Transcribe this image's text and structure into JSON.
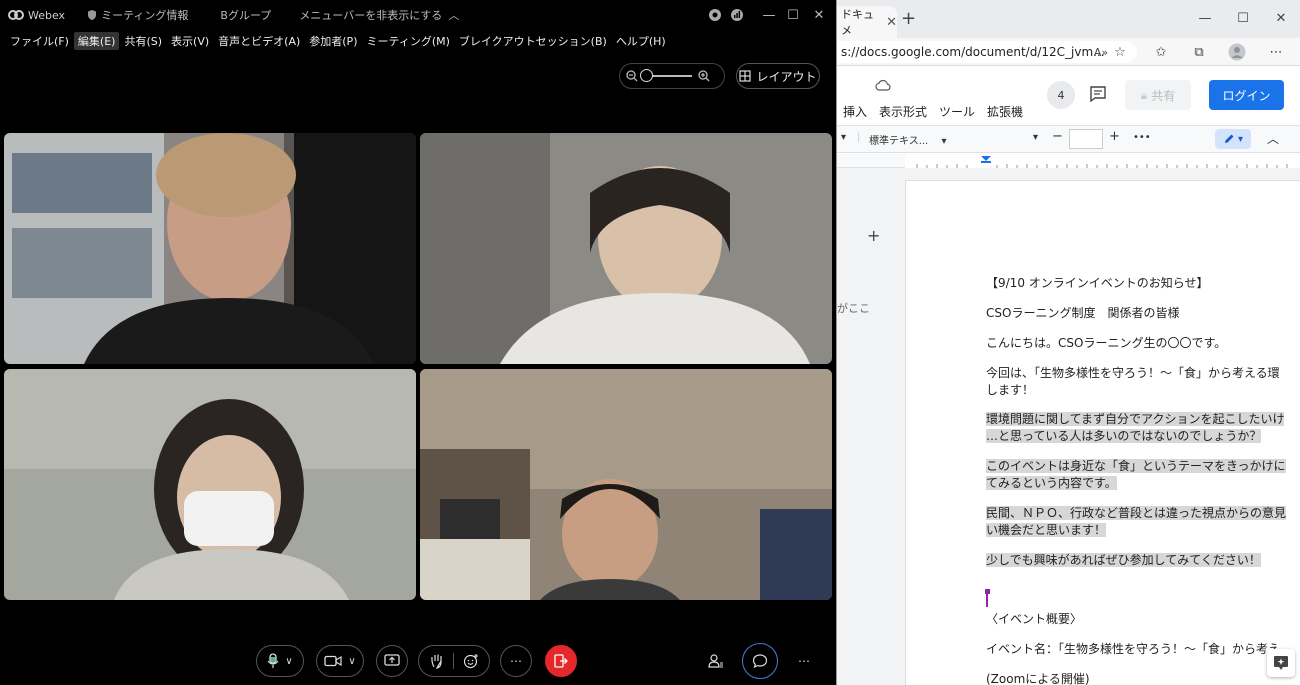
{
  "webex": {
    "app_name": "Webex",
    "meeting_info": "ミーティング情報",
    "group_name": "Bグループ",
    "hide_menubar": "メニューバーを非表示にする",
    "menus": [
      "ファイル(F)",
      "編集(E)",
      "共有(S)",
      "表示(V)",
      "音声とビデオ(A)",
      "参加者(P)",
      "ミーティング(M)",
      "ブレイクアウトセッション(B)",
      "ヘルプ(H)"
    ],
    "layout_label": "レイアウト",
    "controls": {
      "mic": "microphone-icon",
      "video": "video-camera-icon",
      "share": "share-screen-icon",
      "raise_hand": "raise-hand-icon",
      "reactions": "reactions-icon",
      "more": "more-icon",
      "leave": "leave-meeting-icon",
      "participants": "participants-icon",
      "chat": "chat-icon"
    }
  },
  "browser": {
    "tab_title": "ドキュメ",
    "url": "s://docs.google.com/document/d/12C_jvm...",
    "docs_menus": [
      "挿入",
      "表示形式",
      "ツール",
      "拡張機"
    ],
    "comment_count": "4",
    "share_label": "共有",
    "login_label": "ログイン",
    "style_selector": "標準テキス...",
    "font_size": "",
    "side_text": "がここ",
    "doc": {
      "title": "【9/10 オンラインイベントのお知らせ】",
      "greeting_to": "CSOラーニング制度　関係者の皆様",
      "hello": "こんにちは。CSOラーニング生の〇〇です。",
      "p1_l1": "今回は、「生物多様性を守ろう！～「食」から考える環",
      "p1_l2": "します！",
      "p2_l1": "環境問題に関してまず自分でアクションを起こしたいけ",
      "p2_l2": "…と思っている人は多いのではないのでしょうか？",
      "p3_l1": "このイベントは身近な「食」というテーマをきっかけに",
      "p3_l2": "てみるという内容です。",
      "p4_l1": "民間、ＮＰＯ、行政など普段とは違った視点からの意見",
      "p4_l2": "い機会だと思います！",
      "p5": "少しでも興味があればぜひ参加してみてください！",
      "overview": "〈イベント概要〉",
      "event_name": "イベント名：「生物多様性を守ろう！～「食」から考え",
      "zoom": "(Zoomによる開催)"
    }
  }
}
